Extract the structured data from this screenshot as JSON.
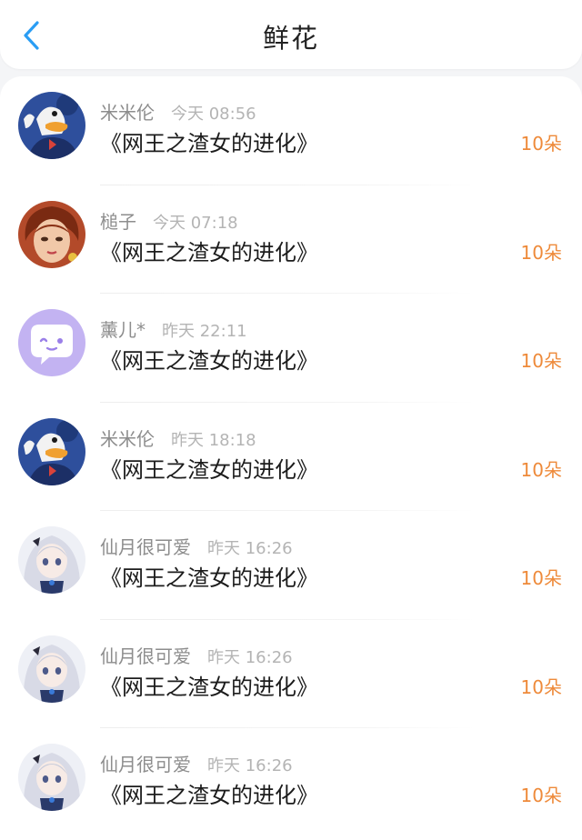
{
  "header": {
    "title": "鲜花",
    "back_icon": "chevron-left-icon",
    "accent_color": "#2a9df4"
  },
  "records": [
    {
      "user": "米米伦",
      "time": "今天 08:56",
      "book": "《网王之渣女的进化》",
      "amount": "10朵",
      "avatar": "donald-duck-avatar"
    },
    {
      "user": "槌子",
      "time": "今天 07:18",
      "book": "《网王之渣女的进化》",
      "amount": "10朵",
      "avatar": "painted-girl-avatar"
    },
    {
      "user": "薰儿*",
      "time": "昨天 22:11",
      "book": "《网王之渣女的进化》",
      "amount": "10朵",
      "avatar": "chat-bubble-avatar"
    },
    {
      "user": "米米伦",
      "time": "昨天 18:18",
      "book": "《网王之渣女的进化》",
      "amount": "10朵",
      "avatar": "donald-duck-avatar"
    },
    {
      "user": "仙月很可爱",
      "time": "昨天 16:26",
      "book": "《网王之渣女的进化》",
      "amount": "10朵",
      "avatar": "anime-girl-avatar"
    },
    {
      "user": "仙月很可爱",
      "time": "昨天 16:26",
      "book": "《网王之渣女的进化》",
      "amount": "10朵",
      "avatar": "anime-girl-avatar"
    },
    {
      "user": "仙月很可爱",
      "time": "昨天 16:26",
      "book": "《网王之渣女的进化》",
      "amount": "10朵",
      "avatar": "anime-girl-avatar"
    }
  ],
  "colors": {
    "amount": "#ee8a3a",
    "username": "#8d8d8d",
    "timestamp": "#b4b4b4",
    "book_title": "#1c1c1c"
  }
}
